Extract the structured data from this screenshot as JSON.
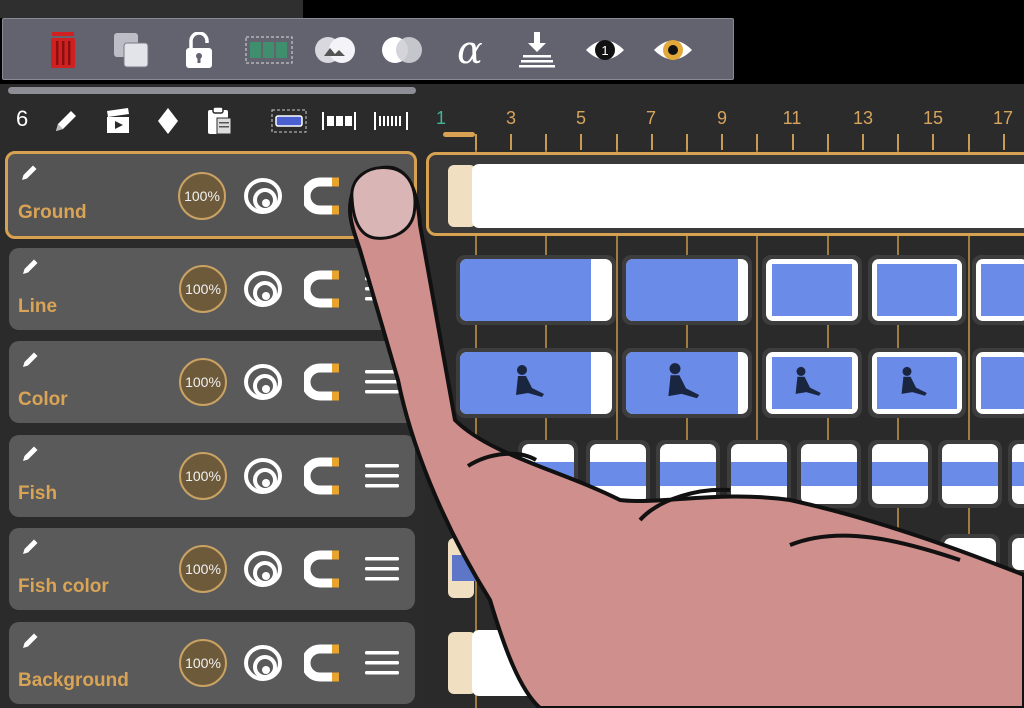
{
  "toolbar": {
    "buttons": [
      {
        "name": "trash-icon"
      },
      {
        "name": "duplicate-icon"
      },
      {
        "name": "lock-icon"
      },
      {
        "name": "select-frames-icon"
      },
      {
        "name": "layer-blend-icon"
      },
      {
        "name": "overlap-icon"
      },
      {
        "name": "alpha-icon",
        "text": "α"
      },
      {
        "name": "import-icon"
      },
      {
        "name": "onion-skin-1-icon",
        "text": "1"
      },
      {
        "name": "onion-skin-eye-icon"
      }
    ]
  },
  "secondary": {
    "frame_count": "6"
  },
  "ruler": {
    "labels": [
      "1",
      "3",
      "5",
      "7",
      "9",
      "11",
      "13",
      "15",
      "17"
    ]
  },
  "layers": [
    {
      "name": "Ground",
      "opacity": "100%",
      "selected": true
    },
    {
      "name": "Line",
      "opacity": "100%"
    },
    {
      "name": "Color",
      "opacity": "100%"
    },
    {
      "name": "Fish",
      "opacity": "100%"
    },
    {
      "name": "Fish color",
      "opacity": "100%"
    },
    {
      "name": "Background",
      "opacity": "100%"
    }
  ],
  "colors": {
    "accent": "#d7a152",
    "frame_blue": "#6a8be8",
    "panel": "#5a5a5a",
    "toolbar": "#636370",
    "trash_red": "#d02020"
  }
}
